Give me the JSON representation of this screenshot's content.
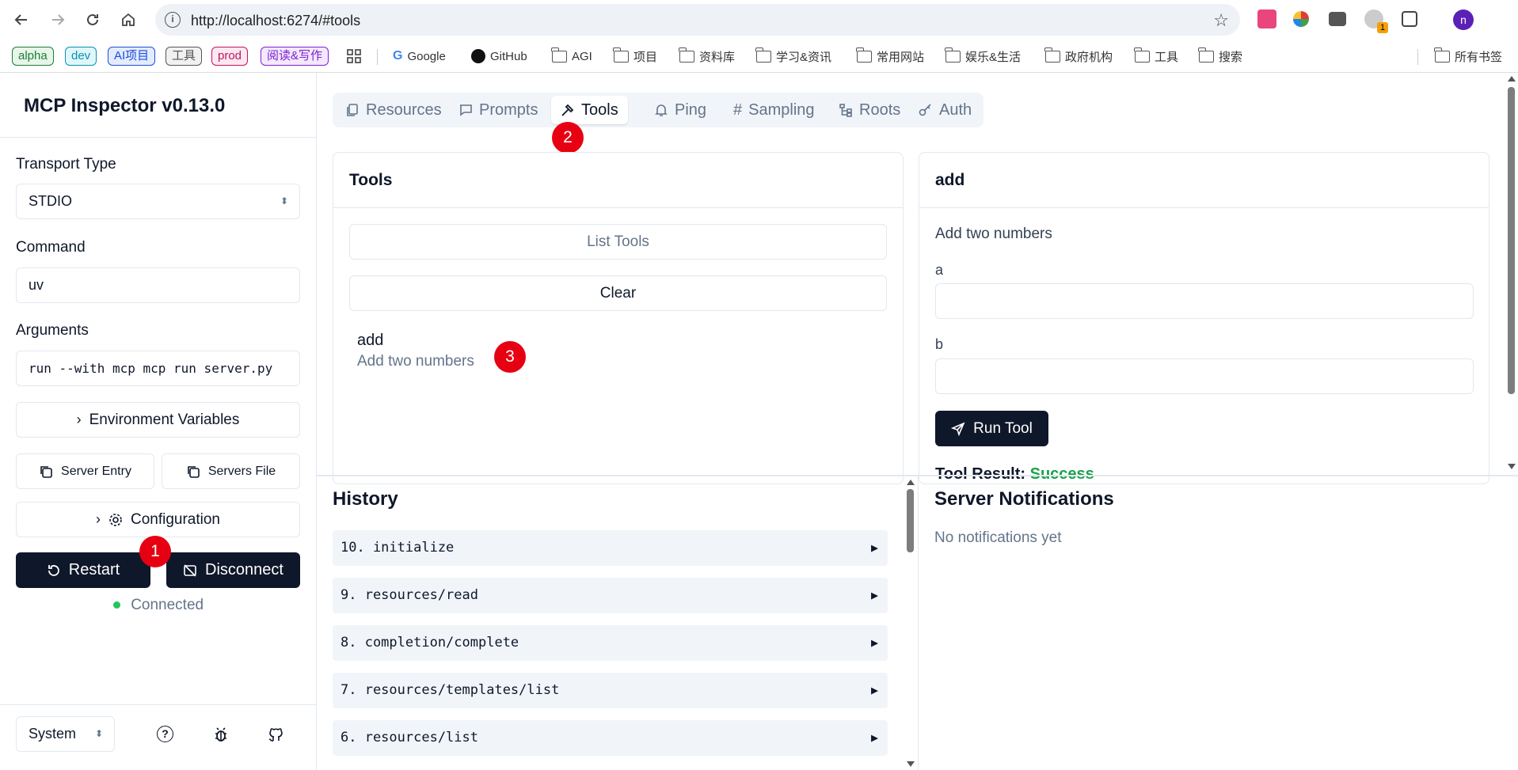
{
  "browser": {
    "url": "http://localhost:6274/#tools",
    "info_glyph": "i",
    "profile_initial": "n",
    "ext_badge": "1",
    "bookmark_tags": [
      {
        "label": "alpha",
        "color": "#1a7f37",
        "bg": "#e8f5e9"
      },
      {
        "label": "dev",
        "color": "#0891b2",
        "bg": "#e0f7fa"
      },
      {
        "label": "AI项目",
        "color": "#1d4ed8",
        "bg": "#e3ecff"
      },
      {
        "label": "工具",
        "color": "#555555",
        "bg": "#f1f1f1"
      },
      {
        "label": "prod",
        "color": "#be185d",
        "bg": "#fde7f1"
      },
      {
        "label": "阅读&写作",
        "color": "#7e22ce",
        "bg": "#f3e8ff"
      }
    ],
    "bookmarks": [
      {
        "label": "Google",
        "icon": "google-icon"
      },
      {
        "label": "GitHub",
        "icon": "github-icon"
      },
      {
        "label": "AGI",
        "icon": "folder-icon"
      },
      {
        "label": "项目",
        "icon": "folder-icon"
      },
      {
        "label": "资料库",
        "icon": "folder-icon"
      },
      {
        "label": "学习&资讯",
        "icon": "folder-icon"
      },
      {
        "label": "常用网站",
        "icon": "folder-icon"
      },
      {
        "label": "娱乐&生活",
        "icon": "folder-icon"
      },
      {
        "label": "政府机构",
        "icon": "folder-icon"
      },
      {
        "label": "工具",
        "icon": "folder-icon"
      },
      {
        "label": "搜索",
        "icon": "folder-icon"
      }
    ],
    "all_bookmarks": "所有书签"
  },
  "sidebar": {
    "title": "MCP Inspector v0.13.0",
    "transport_label": "Transport Type",
    "transport_value": "STDIO",
    "command_label": "Command",
    "command_value": "uv",
    "arguments_label": "Arguments",
    "arguments_value": "run --with mcp mcp run server.py",
    "env_button": "Environment Variables",
    "server_entry_button": "Server Entry",
    "servers_file_button": "Servers File",
    "config_button": "Configuration",
    "restart_button": "Restart",
    "disconnect_button": "Disconnect",
    "status": "Connected",
    "status_color": "#22c55e",
    "theme_value": "System"
  },
  "tabs": [
    {
      "label": "Resources",
      "icon": "resources-icon"
    },
    {
      "label": "Prompts",
      "icon": "prompts-icon"
    },
    {
      "label": "Tools",
      "icon": "hammer-icon"
    },
    {
      "label": "Ping",
      "icon": "bell-icon"
    },
    {
      "label": "Sampling",
      "icon": "hash-icon"
    },
    {
      "label": "Roots",
      "icon": "roots-icon"
    },
    {
      "label": "Auth",
      "icon": "key-icon"
    }
  ],
  "active_tab": "Tools",
  "annotations": [
    "1",
    "2",
    "3"
  ],
  "tools_panel": {
    "title": "Tools",
    "list_button": "List Tools",
    "clear_button": "Clear",
    "items": [
      {
        "name": "add",
        "description": "Add two numbers"
      }
    ]
  },
  "tool_detail": {
    "title": "add",
    "description": "Add two numbers",
    "param_a": "a",
    "param_b": "b",
    "run_button": "Run Tool",
    "result_label": "Tool Result:",
    "result_status": "Success",
    "success_color": "#16a34a"
  },
  "history": {
    "title": "History",
    "items": [
      "10. initialize",
      "9. resources/read",
      "8. completion/complete",
      "7. resources/templates/list",
      "6. resources/list"
    ]
  },
  "notifications": {
    "title": "Server Notifications",
    "empty": "No notifications yet"
  }
}
